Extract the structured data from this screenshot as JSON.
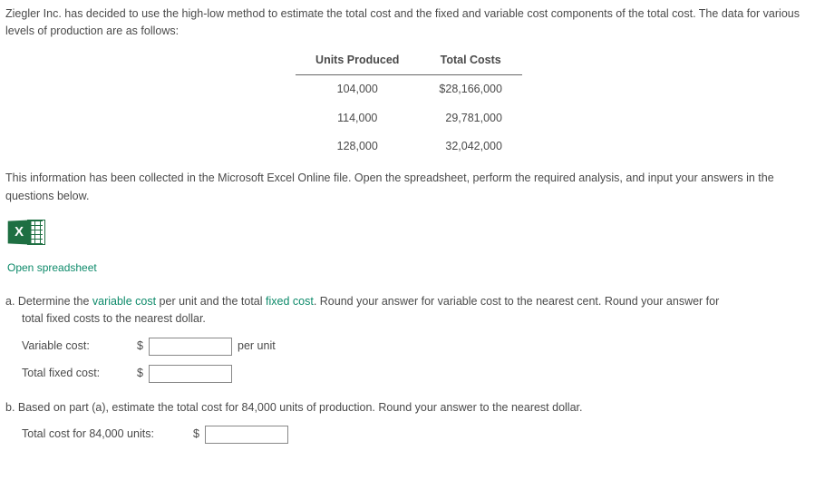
{
  "intro": "Ziegler Inc. has decided to use the high-low method to estimate the total cost and the fixed and variable cost components of the total cost. The data for various levels of production are as follows:",
  "table": {
    "headers": {
      "units": "Units Produced",
      "costs": "Total Costs"
    },
    "rows": [
      {
        "units": "104,000",
        "cost": "$28,166,000"
      },
      {
        "units": "114,000",
        "cost": "29,781,000"
      },
      {
        "units": "128,000",
        "cost": "32,042,000"
      }
    ]
  },
  "instruction": "This information has been collected in the Microsoft Excel Online file. Open the spreadsheet, perform the required analysis, and input your answers in the questions below.",
  "excel": {
    "letter": "X",
    "link": "Open spreadsheet"
  },
  "qa": {
    "prefix": "a. Determine the ",
    "vc": "variable cost",
    "mid": " per unit and the total ",
    "fc": "fixed cost",
    "suffix1": ". Round your answer for variable cost to the nearest cent. Round your answer for",
    "suffix2": "total fixed costs to the nearest dollar."
  },
  "fields": {
    "variable_label": "Variable cost:",
    "fixed_label": "Total fixed cost:",
    "per_unit": "per unit",
    "dollar": "$"
  },
  "qb": "b. Based on part (a), estimate the total cost for 84,000 units of production. Round your answer to the nearest dollar.",
  "qb_field": {
    "label": "Total cost for 84,000 units:"
  }
}
